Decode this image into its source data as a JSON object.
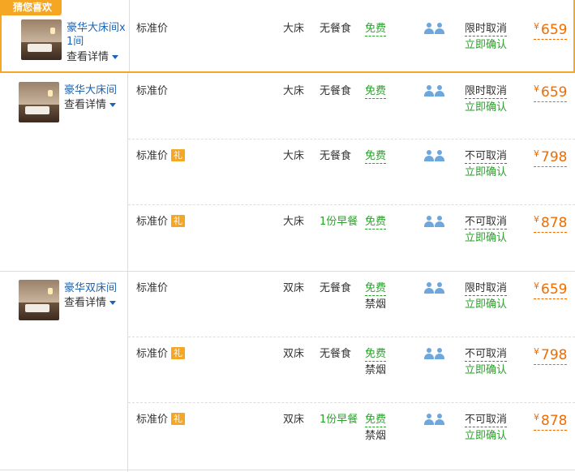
{
  "favorite_tag": "猜您喜欢",
  "yen": "¥",
  "groups": [
    {
      "room_name_lines": [
        "豪华大床间x",
        "1间"
      ],
      "details_label": "查看详情",
      "rows": [
        {
          "plan": "标准价",
          "gift": "",
          "bed": "大床",
          "meal": "无餐食",
          "wifi": "免费",
          "smoke": "",
          "cancel": "限时取消",
          "confirm": "立即确认",
          "price": "659"
        }
      ]
    },
    {
      "room_name_lines": [
        "豪华大床间"
      ],
      "details_label": "查看详情",
      "rows": [
        {
          "plan": "标准价",
          "gift": "",
          "bed": "大床",
          "meal": "无餐食",
          "wifi": "免费",
          "smoke": "",
          "cancel": "限时取消",
          "confirm": "立即确认",
          "price": "659"
        },
        {
          "plan": "标准价",
          "gift": "礼",
          "bed": "大床",
          "meal": "无餐食",
          "wifi": "免费",
          "smoke": "",
          "cancel": "不可取消",
          "confirm": "立即确认",
          "price": "798"
        },
        {
          "plan": "标准价",
          "gift": "礼",
          "bed": "大床",
          "meal": "1份早餐",
          "wifi": "免费",
          "smoke": "",
          "cancel": "不可取消",
          "confirm": "立即确认",
          "price": "878"
        }
      ]
    },
    {
      "room_name_lines": [
        "豪华双床间"
      ],
      "details_label": "查看详情",
      "rows": [
        {
          "plan": "标准价",
          "gift": "",
          "bed": "双床",
          "meal": "无餐食",
          "wifi": "免费",
          "smoke": "禁烟",
          "cancel": "限时取消",
          "confirm": "立即确认",
          "price": "659"
        },
        {
          "plan": "标准价",
          "gift": "礼",
          "bed": "双床",
          "meal": "无餐食",
          "wifi": "免费",
          "smoke": "禁烟",
          "cancel": "不可取消",
          "confirm": "立即确认",
          "price": "798"
        },
        {
          "plan": "标准价",
          "gift": "礼",
          "bed": "双床",
          "meal": "1份早餐",
          "wifi": "免费",
          "smoke": "禁烟",
          "cancel": "不可取消",
          "confirm": "立即确认",
          "price": "878"
        }
      ]
    }
  ]
}
